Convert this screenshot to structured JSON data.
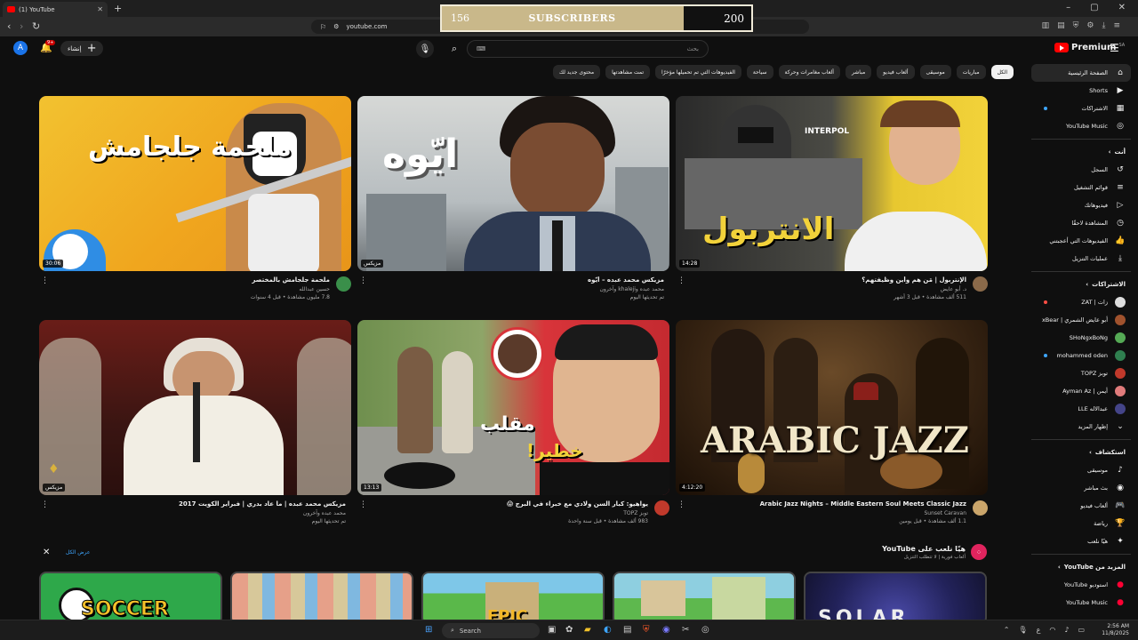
{
  "browser": {
    "tab_title": "(1) YouTube",
    "url": "youtube.com"
  },
  "overlay": {
    "left_value": "156",
    "label": "SUBSCRIBERS",
    "right_value": "200"
  },
  "header": {
    "avatar_letter": "A",
    "notif_count": "9+",
    "create_label": "إنشاء",
    "search_placeholder": "بحث",
    "logo_text": "Premium",
    "logo_region": "SA"
  },
  "chips": [
    "الكل",
    "مباريات",
    "موسيقى",
    "ألعاب فيديو",
    "مباشر",
    "ألعاب مغامرات وحركة",
    "سياحة",
    "الفيديوهات التي تم تحميلها مؤخرًا",
    "تمت مشاهدتها",
    "محتوى جديد لك"
  ],
  "videos": [
    {
      "title": "ملحمة جلجامش بالمختصر",
      "channel": "حسين عبدالله",
      "stats": "7.8 مليون مشاهدة • قبل 4 سنوات",
      "duration": "30:06",
      "thumb_text": "ملحمة جلجامش",
      "avatar_color": "#3a8f4a"
    },
    {
      "title": "مزيكس محمد عبده – أيّوه",
      "channel": "محمد عبده وkhaleji وآخرون",
      "stats": "تم تحديثها اليوم",
      "duration": "مزيكس",
      "thumb_text": "ايّوه",
      "avatar_color": "#444444"
    },
    {
      "title": "الإنتربول | مَن هم وأين وظيفتهم؟",
      "channel": "د. أبو عايض",
      "stats": "511 ألف مشاهدة • قبل 3 أشهر",
      "duration": "14:28",
      "thumb_text": "الانتربول",
      "thumb_text2": "INTERPOL",
      "avatar_color": "#8b6a4a"
    },
    {
      "title": "مزيكس محمد عبده | ما عاد بدري | فبراير الكويت 2017",
      "channel": "محمد عبده وآخرون",
      "stats": "تم تحديثها اليوم",
      "duration": "مزيكس",
      "avatar_color": "#444444"
    },
    {
      "title": "يواهيو: كبار السن ولادي مع خبراء في البرج 😱",
      "channel": "توبز TOPZ",
      "stats": "983 ألف مشاهدة • قبل سنة واحدة",
      "duration": "13:13",
      "thumb_text": "مقلب",
      "thumb_text2": "خطير!",
      "avatar_color": "#c0392b"
    },
    {
      "title": "Arabic Jazz Nights – Middle Eastern Soul Meets Classic Jazz",
      "channel": "Sunset Caravan",
      "stats": "1.1 ألف مشاهدة • قبل يومين",
      "duration": "4:12:20",
      "thumb_text": "ARABIC JAZZ",
      "avatar_color": "#caa56a"
    }
  ],
  "shelf": {
    "title": "هيّا نلعب على YouTube",
    "subtitle": "ألعاب فورية | لا تتطلب التنزيل",
    "show_all": "عرض الكل",
    "games": [
      {
        "label": "SOCCER",
        "color": "#2ea84a"
      },
      {
        "label": "",
        "color": "#5aa8d8"
      },
      {
        "label": "EPIC",
        "color": "#7ec7e8"
      },
      {
        "label": "",
        "color": "#8ecfe0"
      },
      {
        "label": "SOLAR",
        "color": "#2a2a6a"
      }
    ]
  },
  "sidebar": {
    "main": [
      {
        "label": "الصفحة الرئيسية",
        "icon": "home-icon",
        "glyph": "⌂",
        "active": true
      },
      {
        "label": "Shorts",
        "icon": "shorts-icon",
        "glyph": "▶"
      },
      {
        "label": "الاشتراكات",
        "icon": "subscriptions-icon",
        "glyph": "▦",
        "dot": true
      },
      {
        "label": "YouTube Music",
        "icon": "music-icon",
        "glyph": "◎"
      }
    ],
    "you_header": "أنت",
    "you": [
      {
        "label": "السجل",
        "icon": "history-icon",
        "glyph": "↺"
      },
      {
        "label": "قوائم التشغيل",
        "icon": "playlist-icon",
        "glyph": "≡"
      },
      {
        "label": "فيديوهاتك",
        "icon": "your-videos-icon",
        "glyph": "▷"
      },
      {
        "label": "المشاهدة لاحقًا",
        "icon": "watch-later-icon",
        "glyph": "◷"
      },
      {
        "label": "الفيديوهات التي أعجبتني",
        "icon": "like-icon",
        "glyph": "👍"
      },
      {
        "label": "عمليات التنزيل",
        "icon": "download-icon",
        "glyph": "⤓"
      }
    ],
    "subs_header": "الاشتراكات",
    "subs": [
      {
        "label": "زات | ZAT",
        "color": "#dddddd",
        "dot": "red"
      },
      {
        "label": "أبو عايض الشمري | xBear",
        "color": "#a0522d"
      },
      {
        "label": "SHoNgxBoNg",
        "color": "#55aa55"
      },
      {
        "label": "mohammed oden",
        "color": "#2f7f4f",
        "dot": "blue"
      },
      {
        "label": "توبز TOPZ",
        "color": "#c0392b"
      },
      {
        "label": "أيمن | Ayman Az",
        "color": "#e07b7b"
      },
      {
        "label": "عبدالاله LLE",
        "color": "#444488"
      },
      {
        "label": "إظهار المزيد",
        "glyph": "⌄"
      }
    ],
    "explore_header": "استكشاف",
    "explore": [
      {
        "label": "موسيقى",
        "icon": "music-note-icon",
        "glyph": "♪"
      },
      {
        "label": "بث مباشر",
        "icon": "live-icon",
        "glyph": "◉"
      },
      {
        "label": "ألعاب فيديو",
        "icon": "gaming-icon",
        "glyph": "🎮"
      },
      {
        "label": "رياضة",
        "icon": "trophy-icon",
        "glyph": "🏆"
      },
      {
        "label": "هيّا نلعب",
        "icon": "playables-icon",
        "glyph": "✦"
      }
    ],
    "more_header": "المزيد من YouTube",
    "more": [
      {
        "label": "استوديو YouTube",
        "icon": "studio-icon",
        "glyph": "●"
      },
      {
        "label": "YouTube Music",
        "icon": "yt-music-icon",
        "glyph": "●"
      }
    ]
  },
  "taskbar": {
    "search_label": "Search",
    "time": "2:56 AM",
    "date": "11/8/2025"
  }
}
